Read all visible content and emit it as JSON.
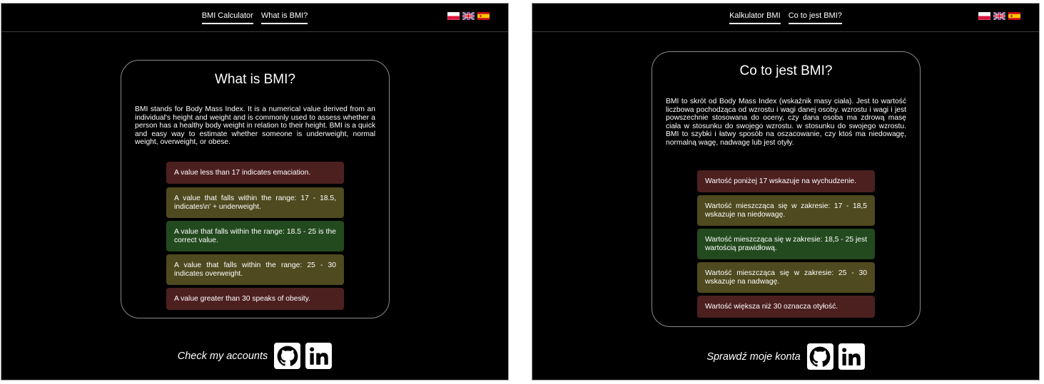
{
  "en": {
    "nav": [
      "BMI Calculator",
      "What is BMI?"
    ],
    "title": "What is BMI?",
    "description": "BMI stands for Body Mass Index. It is a numerical value derived from an individual's height and weight and is commonly used to assess whether a person has a healthy body weight in relation to their height. BMI is a quick and easy way to estimate whether someone is underweight, normal weight, overweight, or obese.",
    "ranges": [
      "A value less than 17 indicates emaciation.",
      "A value that falls within the range: 17 - 18.5, indicates\\n' + underweight.",
      "A value that falls within the range: 18.5 - 25 is the correct value.",
      "A value that falls within the range: 25 - 30 indicates overweight.",
      "A value greater than 30 speaks of obesity."
    ],
    "footer": "Check my accounts"
  },
  "pl": {
    "nav": [
      "Kalkulator BMI",
      "Co to jest BMI?"
    ],
    "title": "Co to jest BMI?",
    "description": "BMI to skrót od Body Mass Index (wskaźnik masy ciała). Jest to wartość liczbowa pochodząca od wzrostu i wagi danej osoby. wzrostu i wagi i jest powszechnie stosowana do oceny, czy dana osoba ma zdrową masę ciała w stosunku do swojego wzrostu. w stosunku do swojego wzrostu. BMI to szybki i łatwy sposób na oszacowanie, czy ktoś ma niedowagę, normalną wagę, nadwagę lub jest otyły.",
    "ranges": [
      "Wartość poniżej 17 wskazuje na wychudzenie.",
      "Wartość mieszcząca się w zakresie: 17 - 18,5 wskazuje na niedowagę.",
      "Wartość mieszcząca się w zakresie: 18,5 - 25 jest wartością prawidłową.",
      "Wartość mieszcząca się w zakresie: 25 - 30 wskazuje na nadwagę.",
      "Wartość większa niż 30 oznacza otyłość."
    ],
    "footer": "Sprawdź moje konta"
  },
  "colors": {
    "emaciation": "#4d2020",
    "underweight": "#4f4a1f",
    "normal": "#234a1e",
    "overweight": "#4f4a1f",
    "obesity": "#4d2020"
  },
  "icons": {
    "flags": [
      "poland-flag-icon",
      "uk-flag-icon",
      "spain-flag-icon"
    ],
    "social": [
      "github-icon",
      "linkedin-icon"
    ]
  }
}
